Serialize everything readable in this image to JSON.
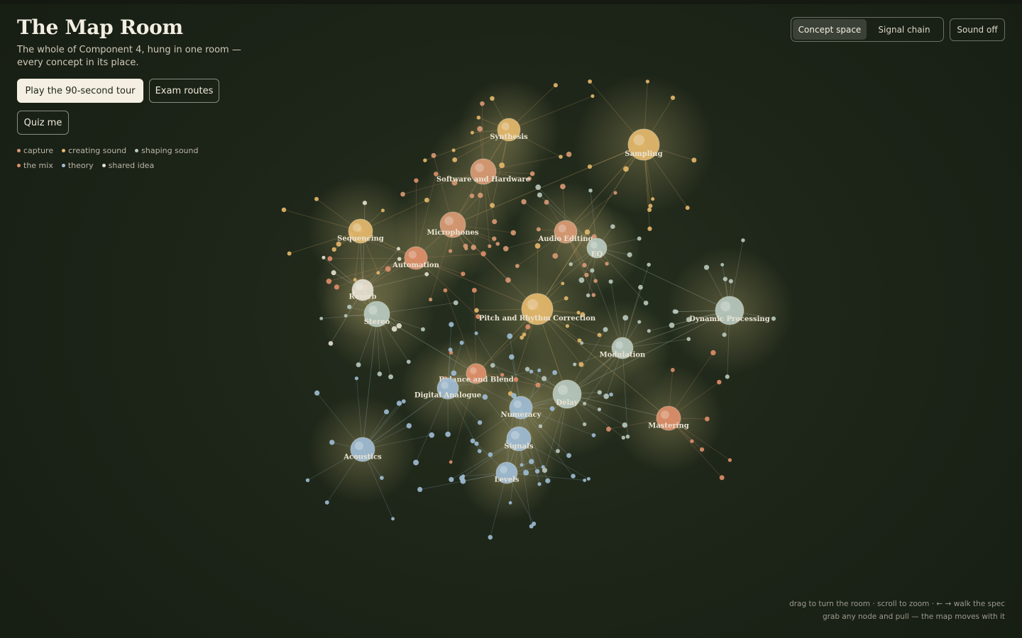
{
  "header": {
    "title": "The Map Room",
    "subtitle": "The whole of Component 4, hung in one room — every concept in its place."
  },
  "actions": {
    "tour_label": "Play the 90-second tour",
    "routes_label": "Exam routes",
    "quiz_label": "Quiz me"
  },
  "legend": [
    {
      "label": "capture",
      "color": "#d99a74"
    },
    {
      "label": "creating sound",
      "color": "#e5b86c"
    },
    {
      "label": "shaping sound",
      "color": "#b9c9bf"
    },
    {
      "label": "the mix",
      "color": "#e08f6a"
    },
    {
      "label": "theory",
      "color": "#9fbcd4"
    },
    {
      "label": "shared idea",
      "color": "#e6e1d2"
    }
  ],
  "view_toggle": {
    "concept_label": "Concept space",
    "signal_label": "Signal chain",
    "active": "concept"
  },
  "sound": {
    "label": "Sound off"
  },
  "hints": {
    "line1": "drag to turn the room · scroll to zoom · ← → walk the spec",
    "line2": "grab any node and pull — the map moves with it"
  },
  "graph": {
    "hubs": [
      {
        "label": "Synthesis",
        "group": "creating sound"
      },
      {
        "label": "Sampling",
        "group": "creating sound"
      },
      {
        "label": "Software and Hardware",
        "group": "capture"
      },
      {
        "label": "Microphones",
        "group": "capture"
      },
      {
        "label": "Sequencing",
        "group": "creating sound"
      },
      {
        "label": "Automation",
        "group": "the mix"
      },
      {
        "label": "Audio Editing",
        "group": "capture"
      },
      {
        "label": "EQ",
        "group": "shaping sound"
      },
      {
        "label": "Reverb",
        "group": "shared idea"
      },
      {
        "label": "Stereo",
        "group": "shaping sound"
      },
      {
        "label": "Pitch and Rhythm Correction",
        "group": "creating sound"
      },
      {
        "label": "Dynamic Processing",
        "group": "shaping sound"
      },
      {
        "label": "Modulation",
        "group": "shaping sound"
      },
      {
        "label": "Balance and Blend",
        "group": "the mix"
      },
      {
        "label": "Digital Analogue",
        "group": "theory"
      },
      {
        "label": "Delay",
        "group": "shaping sound"
      },
      {
        "label": "Numeracy",
        "group": "theory"
      },
      {
        "label": "Mastering",
        "group": "the mix"
      },
      {
        "label": "Signals",
        "group": "theory"
      },
      {
        "label": "Acoustics",
        "group": "theory"
      },
      {
        "label": "Levels",
        "group": "theory"
      }
    ]
  }
}
